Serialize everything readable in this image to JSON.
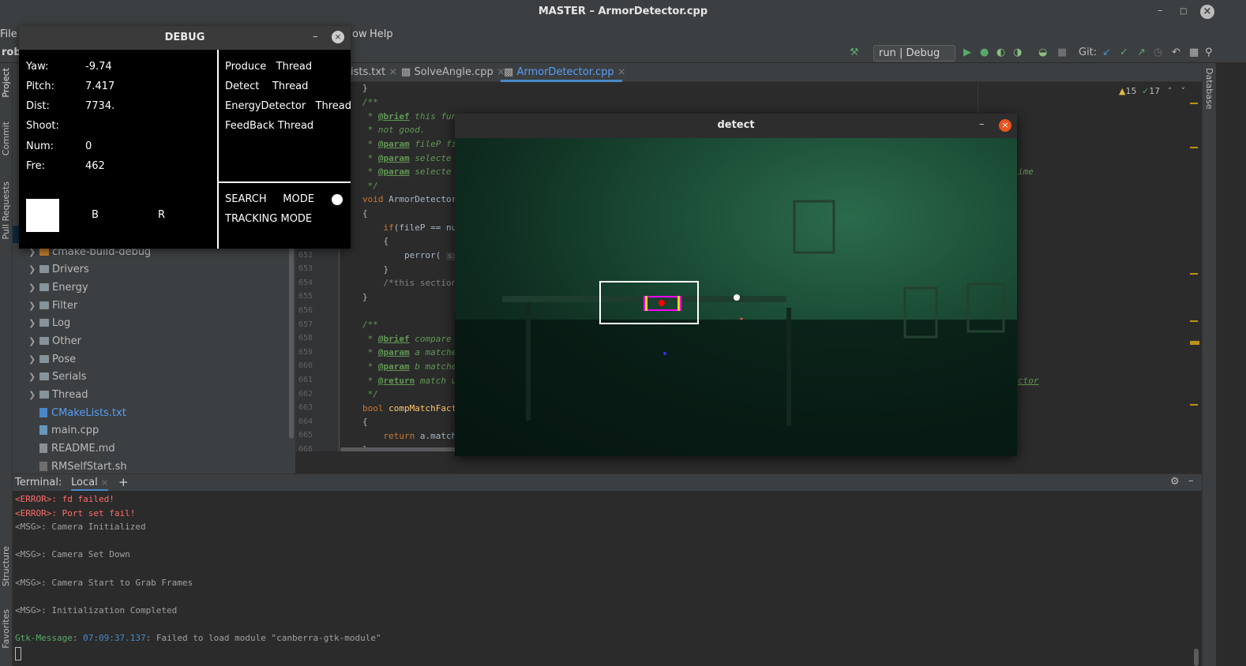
{
  "window": {
    "title": "MASTER – ArmorDetector.cpp"
  },
  "menu": {
    "file": "File",
    "window_partial": "ow",
    "help": "Help"
  },
  "toolbar": {
    "project_partial": "rob",
    "run_config": "run | Debug",
    "git_label": "Git:"
  },
  "left_strip": {
    "project": "Project",
    "commit": "Commit",
    "pull_requests": "Pull Requests",
    "structure": "Structure",
    "favorites": "Favorites"
  },
  "right_strip": {
    "database": "Database"
  },
  "project_tree": [
    {
      "label": "cmake-build-debug",
      "type": "folder-orange"
    },
    {
      "label": "Drivers",
      "type": "folder"
    },
    {
      "label": "Energy",
      "type": "folder"
    },
    {
      "label": "Filter",
      "type": "folder"
    },
    {
      "label": "Log",
      "type": "folder"
    },
    {
      "label": "Other",
      "type": "folder"
    },
    {
      "label": "Pose",
      "type": "folder"
    },
    {
      "label": "Serials",
      "type": "folder"
    },
    {
      "label": "Thread",
      "type": "folder"
    },
    {
      "label": "CMakeLists.txt",
      "type": "file"
    },
    {
      "label": "main.cpp",
      "type": "file"
    },
    {
      "label": "README.md",
      "type": "file"
    },
    {
      "label": "RMSelfStart.sh",
      "type": "file"
    }
  ],
  "tabs": [
    {
      "label": "ists.txt",
      "active": false
    },
    {
      "label": "SolveAngle.cpp",
      "active": false
    },
    {
      "label": "ArmorDetector.cpp",
      "active": true
    }
  ],
  "inspections": {
    "warnings": "15",
    "weak": "17"
  },
  "line_numbers": [
    "652",
    "653",
    "654",
    "655",
    "656",
    "657",
    "658",
    "659",
    "660",
    "661",
    "662",
    "663",
    "664",
    "665",
    "666"
  ],
  "code": {
    "l1": "}",
    "l2": "/**",
    "l3a": " * ",
    "l3tag": "@brief",
    "l3b": " this fun",
    "l4": " * not good.",
    "l5a": " * ",
    "l5tag": "@param",
    "l5b": " fileP fi",
    "l6a": " * ",
    "l6tag": "@param",
    "l6b": " selecte",
    "l7a": " * ",
    "l7tag": "@param",
    "l7b": " selecte",
    "l8": " */",
    "l9a": "void ",
    "l9b": "ArmorDetector",
    "l10": "{",
    "l11a": "    ",
    "l11kw": "if",
    "l11b": "(fileP == nu",
    "l12": "    {",
    "l13a": "        perror( ",
    "l13hint": "s:",
    "l14": "    }",
    "l15": "    /*this section",
    "l16": "}",
    "l17": "/**",
    "l18a": " * ",
    "l18tag": "@brief",
    "l18b": " compare",
    "l19a": " * ",
    "l19tag": "@param",
    "l19b": " a matche",
    "l20a": " * ",
    "l20tag": "@param",
    "l20b": " b matche",
    "l21a": " * ",
    "l21tag": "@return",
    "l21b": " match u",
    "l22": " */",
    "l23a": "bool ",
    "l23b": "compMatchFact",
    "l24": "{",
    "l25a": "    ",
    "l25kw": "return",
    "l25b": " a.match",
    "l26": "}",
    "right_frag1": "ime",
    "right_frag2": "ctor"
  },
  "terminal": {
    "label": "Terminal:",
    "tab": "Local",
    "lines": [
      {
        "text": "<ERROR>: fd failed!",
        "kind": "err"
      },
      {
        "text": "<ERROR>: Port set fail!",
        "kind": "err"
      },
      {
        "text": "<MSG>: Camera Initialized",
        "kind": "msg"
      },
      {
        "text": "<MSG>: Camera Set Down",
        "kind": "msg"
      },
      {
        "text": "<MSG>: Camera Start to Grab Frames",
        "kind": "msg"
      },
      {
        "text": "<MSG>: Initialization Completed",
        "kind": "msg"
      }
    ],
    "gtk_prefix": "Gtk-Message",
    "gtk_time": "07:09:37.137",
    "gtk_rest": ": Failed to load module \"canberra-gtk-module\""
  },
  "debug": {
    "title": "DEBUG",
    "yaw_label": "Yaw:",
    "yaw": "-9.74",
    "pitch_label": "Pitch:",
    "pitch": "7.417",
    "dist_label": "Dist:",
    "dist": "7734.",
    "shoot_label": "Shoot:",
    "num_label": "Num:",
    "num": "0",
    "fre_label": "Fre:",
    "fre": "462",
    "b_label": "B",
    "r_label": "R",
    "threads": [
      "Produce   Thread",
      "Detect    Thread",
      "EnergyDetector   Thread",
      "FeedBack Thread"
    ],
    "search_mode": "SEARCH     MODE",
    "tracking_mode": "TRACKING MODE"
  },
  "detect": {
    "title": "detect"
  },
  "colors": {
    "accent": "#589df6",
    "close_orange": "#e9541f",
    "comment_green": "#629755",
    "error_red": "#ff6b68",
    "armor_magenta": "#ff00ff"
  }
}
